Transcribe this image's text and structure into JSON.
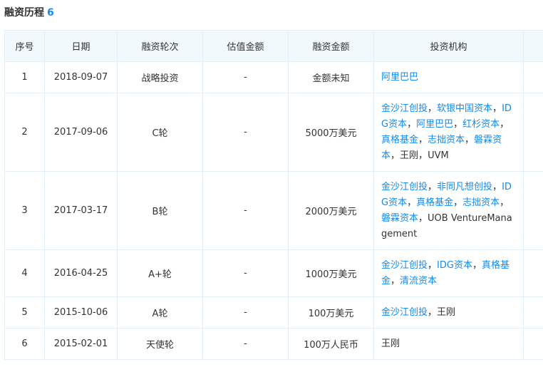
{
  "section": {
    "title": "融资历程",
    "count": "6"
  },
  "table": {
    "headers": [
      "序号",
      "日期",
      "融资轮次",
      "估值金额",
      "融资金额",
      "投资机构",
      ""
    ],
    "rows": [
      {
        "no": "1",
        "date": "2018-09-07",
        "round": "战略投资",
        "valuation": "-",
        "amount": "金额未知",
        "investors": [
          {
            "name": "阿里巴巴",
            "link": true
          }
        ]
      },
      {
        "no": "2",
        "date": "2017-09-06",
        "round": "C轮",
        "valuation": "-",
        "amount": "5000万美元",
        "investors": [
          {
            "name": "金沙江创投",
            "link": true
          },
          {
            "name": "软银中国资本",
            "link": true
          },
          {
            "name": "IDG资本",
            "link": true
          },
          {
            "name": "阿里巴巴",
            "link": true
          },
          {
            "name": "红杉资本",
            "link": true
          },
          {
            "name": "真格基金",
            "link": true
          },
          {
            "name": "志拙资本",
            "link": true
          },
          {
            "name": "磐霖资本",
            "link": true
          },
          {
            "name": "王刚",
            "link": false
          },
          {
            "name": "UVM",
            "link": false
          }
        ]
      },
      {
        "no": "3",
        "date": "2017-03-17",
        "round": "B轮",
        "valuation": "-",
        "amount": "2000万美元",
        "investors": [
          {
            "name": "金沙江创投",
            "link": true
          },
          {
            "name": "非同凡想创投",
            "link": true
          },
          {
            "name": "IDG资本",
            "link": true
          },
          {
            "name": "真格基金",
            "link": true
          },
          {
            "name": "志拙资本",
            "link": true
          },
          {
            "name": "磐霖资本",
            "link": true
          },
          {
            "name": "UOB VentureManagement",
            "link": false
          }
        ]
      },
      {
        "no": "4",
        "date": "2016-04-25",
        "round": "A+轮",
        "valuation": "-",
        "amount": "1000万美元",
        "investors": [
          {
            "name": "金沙江创投",
            "link": true
          },
          {
            "name": "IDG资本",
            "link": true
          },
          {
            "name": "真格基金",
            "link": true
          },
          {
            "name": "清流资本",
            "link": true
          }
        ]
      },
      {
        "no": "5",
        "date": "2015-10-06",
        "round": "A轮",
        "valuation": "-",
        "amount": "100万美元",
        "investors": [
          {
            "name": "金沙江创投",
            "link": true
          },
          {
            "name": "王刚",
            "link": false
          }
        ]
      },
      {
        "no": "6",
        "date": "2015-02-01",
        "round": "天使轮",
        "valuation": "-",
        "amount": "100万人民币",
        "investors": [
          {
            "name": "王刚",
            "link": false
          }
        ]
      }
    ],
    "separator": "，"
  },
  "colors": {
    "accent": "#128bed",
    "header_bg": "#f2f9fc",
    "border": "#e4eef6",
    "text": "#333333"
  }
}
